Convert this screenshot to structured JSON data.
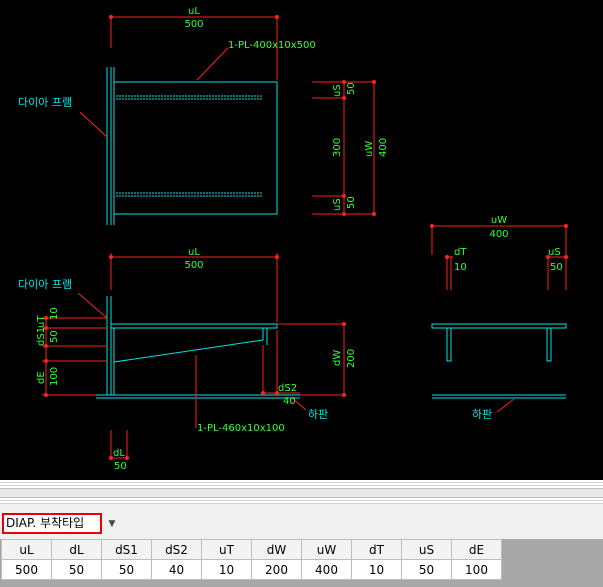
{
  "drawing": {
    "top_view": {
      "dim_uL": "uL",
      "dim_uL_val": "500",
      "plate_label": "1-PL-400x10x500",
      "frame_label": "다이아 프램",
      "dim_uS_top": "uS",
      "dim_uS_top_val": "50",
      "dim_mid_val": "300",
      "dim_uS_bot": "uS",
      "dim_uS_bot_val": "50",
      "dim_uW": "uW",
      "dim_uW_val": "400"
    },
    "side_view": {
      "dim_uL": "uL",
      "dim_uL_val": "500",
      "frame_label": "다이아 프램",
      "dim_uT": "uT",
      "dim_uT_val": "10",
      "dim_dS1": "dS1",
      "dim_dS1_val": "50",
      "dim_dE": "dE",
      "dim_dE_val": "100",
      "dim_dW": "dW",
      "dim_dW_val": "200",
      "dim_dS2": "dS2",
      "dim_dS2_val": "40",
      "bottom_plate_label": "하판",
      "plate_label": "1-PL-460x10x100",
      "dim_dL": "dL",
      "dim_dL_val": "50"
    },
    "front_view": {
      "dim_uW": "uW",
      "dim_uW_val": "400",
      "dim_dT": "dT",
      "dim_dT_val": "10",
      "dim_uS": "uS",
      "dim_uS_val": "50",
      "bottom_plate_label": "하판"
    }
  },
  "type_select": {
    "value": "DIAP. 부착타입",
    "arrow": "▼"
  },
  "param_table": {
    "headers": [
      "uL",
      "dL",
      "dS1",
      "dS2",
      "uT",
      "dW",
      "uW",
      "dT",
      "uS",
      "dE"
    ],
    "values": [
      "500",
      "50",
      "50",
      "40",
      "10",
      "200",
      "400",
      "10",
      "50",
      "100"
    ]
  }
}
